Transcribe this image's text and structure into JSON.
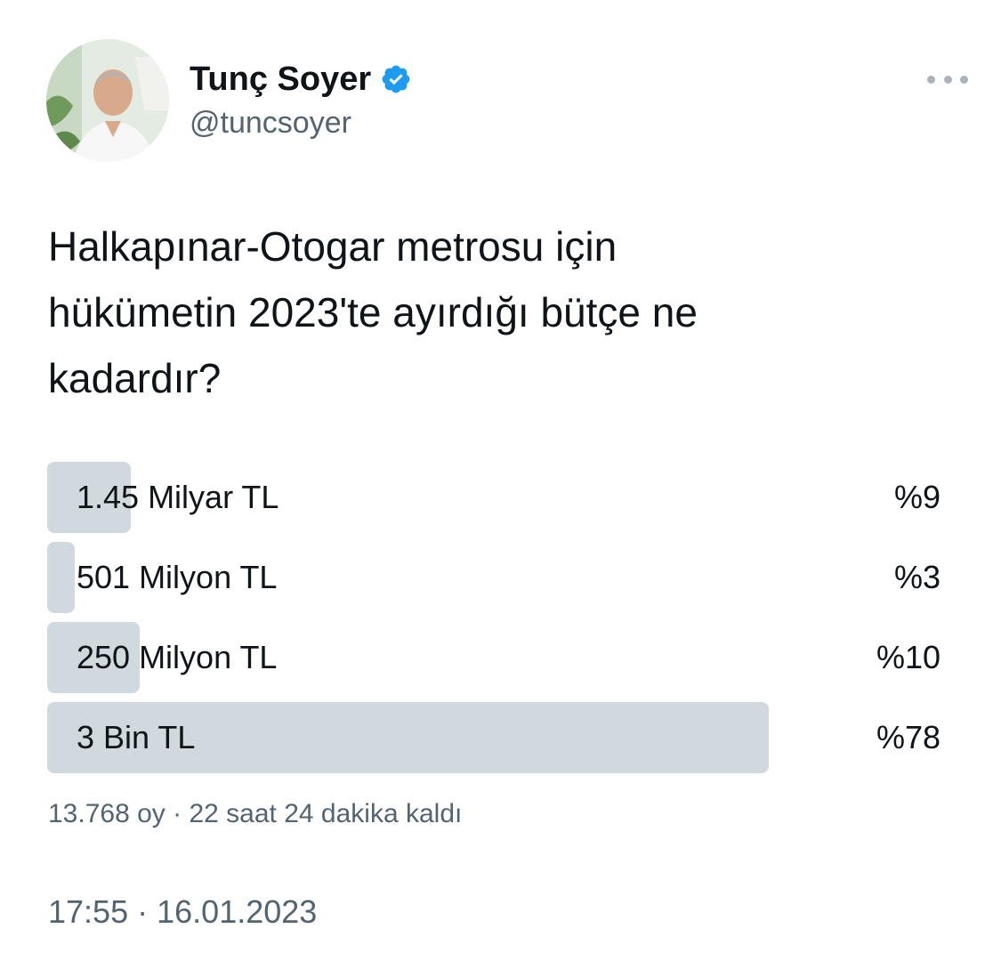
{
  "author": {
    "display_name": "Tunç Soyer",
    "handle": "@tuncsoyer",
    "verified_icon": "verified-badge-icon",
    "verified_color": "#1d9bf0"
  },
  "tweet": {
    "text": "Halkapınar-Otogar metrosu için\nhükümetin 2023'te ayırdığı bütçe ne\nkadardır?"
  },
  "poll": {
    "bar_color": "#cfd9de",
    "options": [
      {
        "label": "1.45 Milyar TL",
        "percent_text": "%9",
        "fraction": 0.09
      },
      {
        "label": "501 Milyon TL",
        "percent_text": "%3",
        "fraction": 0.03
      },
      {
        "label": "250 Milyon TL",
        "percent_text": "%10",
        "fraction": 0.1
      },
      {
        "label": "3 Bin TL",
        "percent_text": "%78",
        "fraction": 0.78
      }
    ],
    "votes": "13.768 oy",
    "separator": "·",
    "time_left": "22 saat 24 dakika kaldı"
  },
  "meta": {
    "time": "17:55",
    "separator": "·",
    "date": "16.01.2023"
  }
}
